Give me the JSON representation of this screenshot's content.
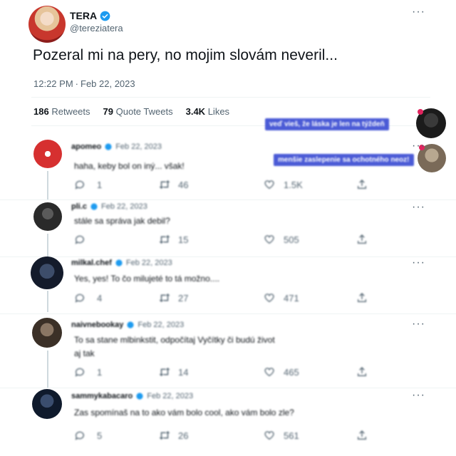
{
  "post": {
    "author_name": "TERA",
    "author_handle": "@tereziatera",
    "text": "Pozeral mi na pery, no mojim slovám neveril...",
    "time": "12:22 PM",
    "date": "Feb 22, 2023",
    "retweets_count": "186",
    "retweets_label": "Retweets",
    "quotes_count": "79",
    "quotes_label": "Quote Tweets",
    "likes_count": "3.4K",
    "likes_label": "Likes"
  },
  "overlay_chips": [
    "veď vieš, že láska je len na týždeň",
    "menšie zaslepenie sa ochotného neoz!"
  ],
  "replies": [
    {
      "name": "apomeo",
      "date": "Feb 22, 2023",
      "text": "haha, keby bol on iný... však!",
      "text2": "",
      "replies": "1",
      "retweets": "46",
      "likes": "1.5K"
    },
    {
      "name": "pli.c",
      "date": "Feb 22, 2023",
      "text": "stále sa správa jak debil?",
      "text2": "",
      "replies": "",
      "retweets": "15",
      "likes": "505"
    },
    {
      "name": "milkal.chef",
      "date": "Feb 22, 2023",
      "text": "Yes, yes! To čo milujeté to tá možno....",
      "text2": "",
      "replies": "4",
      "retweets": "27",
      "likes": "471"
    },
    {
      "name": "naivnebookay",
      "date": "Feb 22, 2023",
      "text": "To sa stane mlbinkstit, odpočítaj Vyčítky či budú život",
      "text2": "aj tak",
      "replies": "1",
      "retweets": "14",
      "likes": "465"
    },
    {
      "name": "sammykabacaro",
      "date": "Feb 22, 2023",
      "text": "Zas spomínaš na to ako vám bolo cool, ako vám bolo zle?",
      "text2": "",
      "replies": "5",
      "retweets": "26",
      "likes": "561"
    }
  ],
  "colors": {
    "verified": "#1d9bf0",
    "chip_bg": "#4b5bd6",
    "text_muted": "#536471"
  },
  "icons": [
    "verified-icon",
    "more-icon",
    "reply-icon",
    "retweet-icon",
    "like-icon",
    "share-icon"
  ]
}
